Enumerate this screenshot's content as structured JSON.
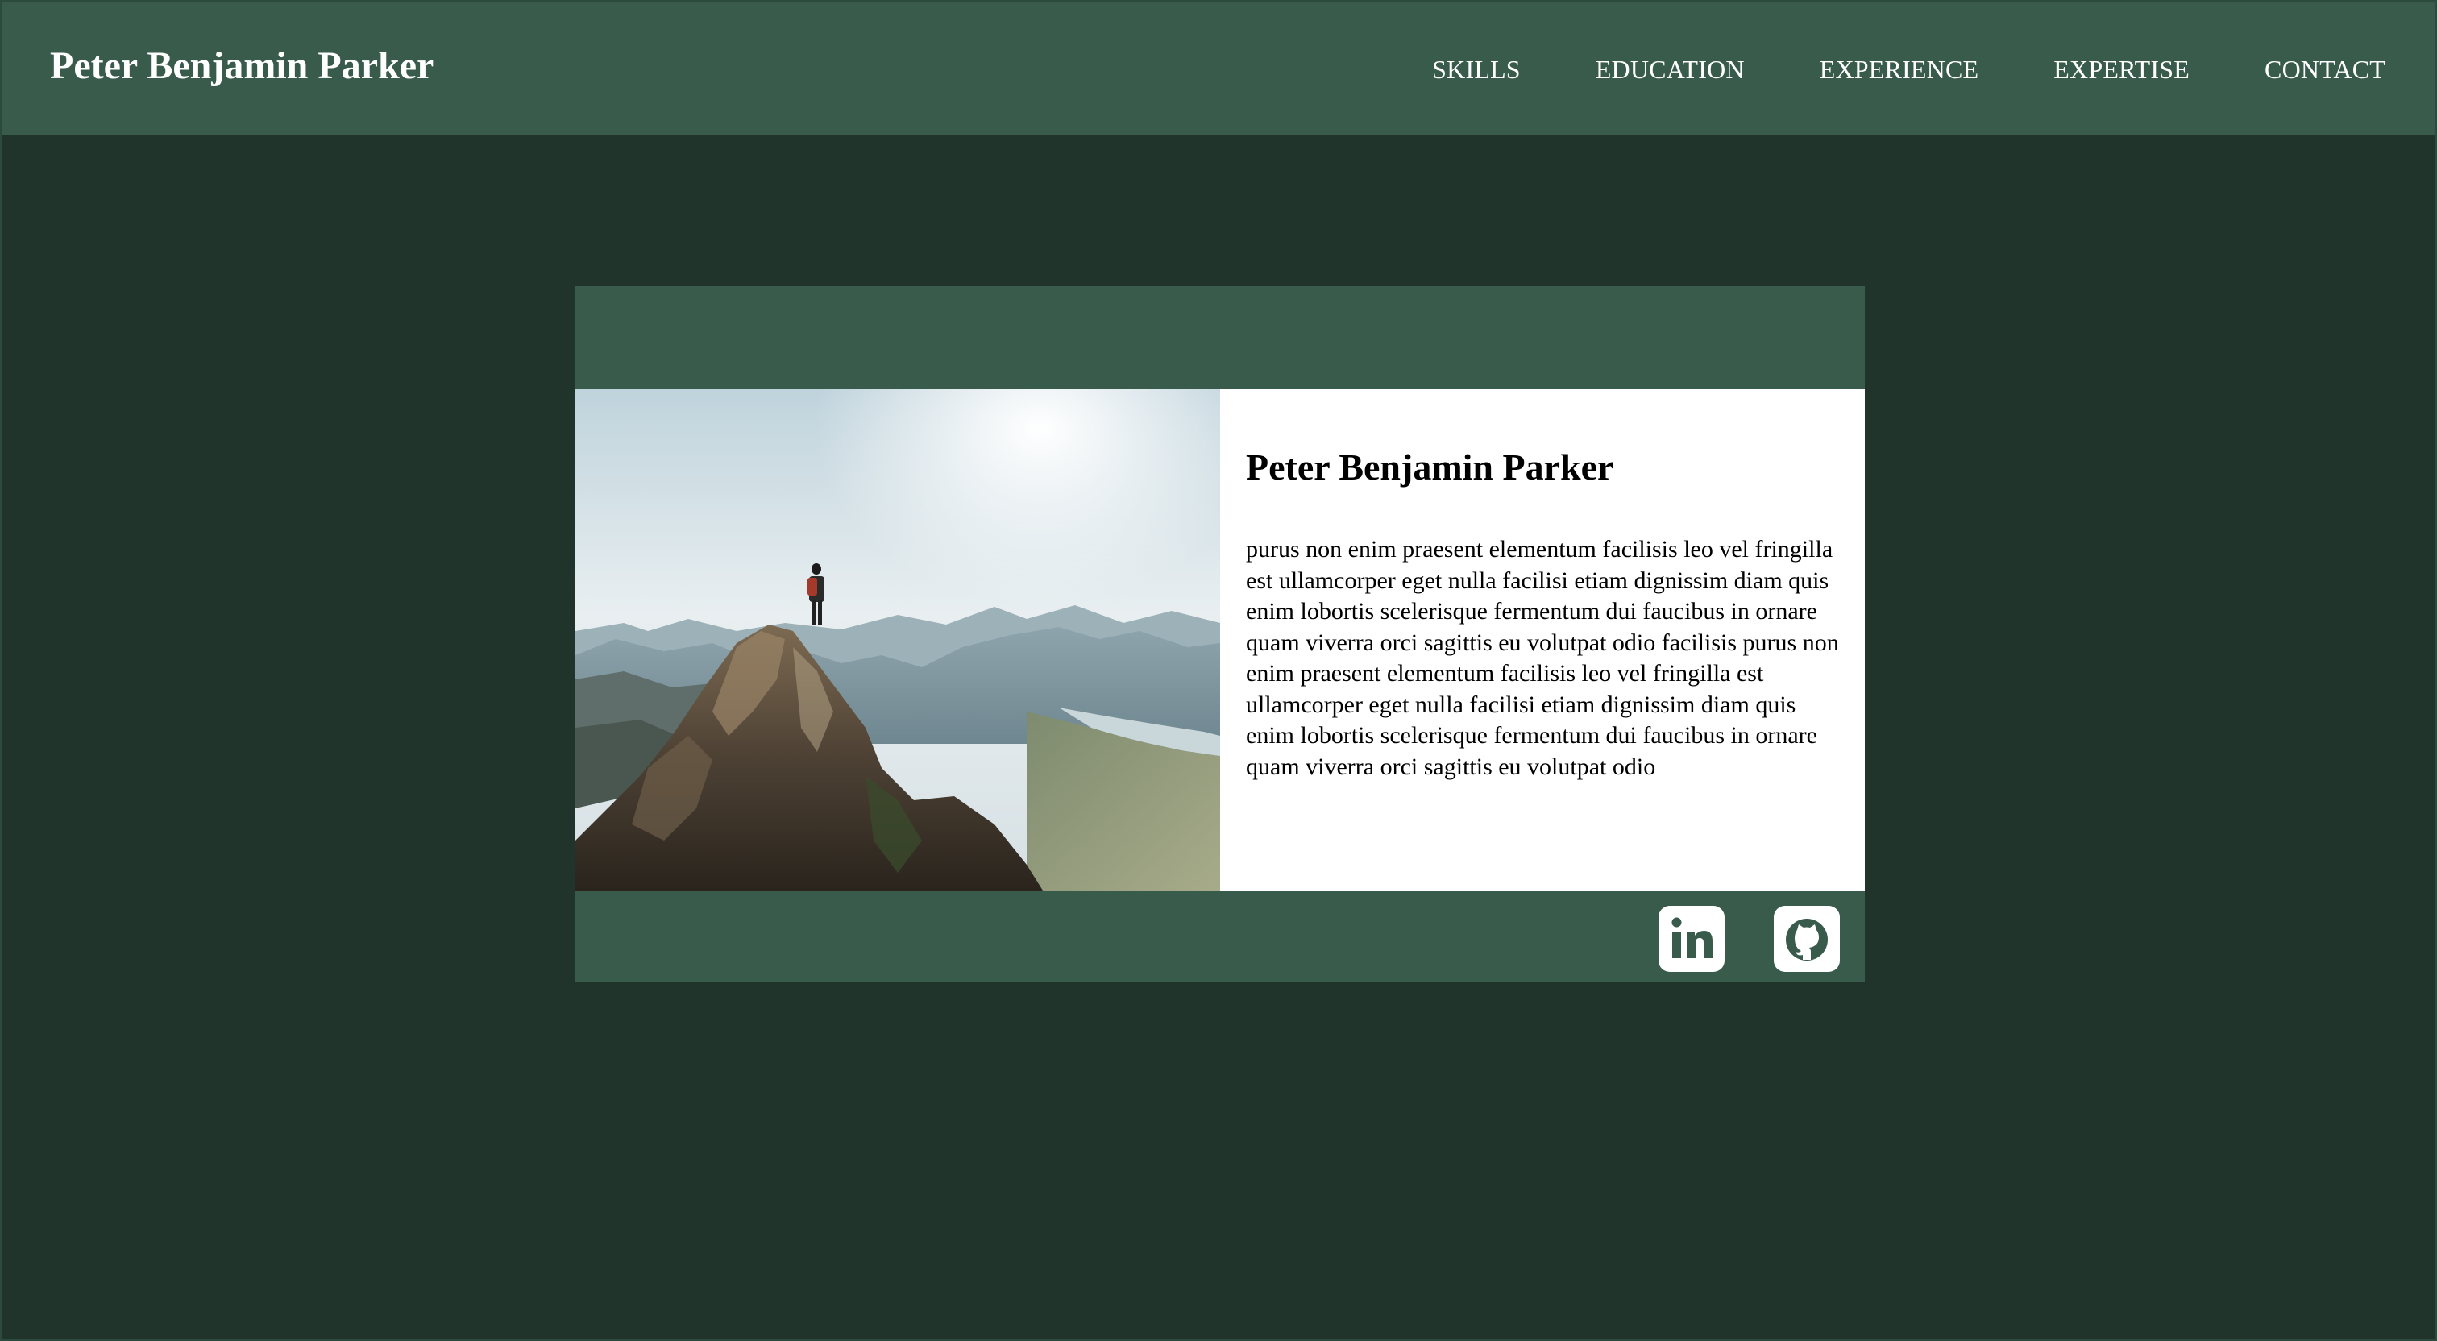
{
  "header": {
    "brand": "Peter Benjamin Parker",
    "nav": [
      {
        "label": "SKILLS"
      },
      {
        "label": "EDUCATION"
      },
      {
        "label": "EXPERIENCE"
      },
      {
        "label": "EXPERTISE"
      },
      {
        "label": "CONTACT"
      }
    ]
  },
  "profile": {
    "name": "Peter Benjamin Parker",
    "bio": "purus non enim praesent elementum facilisis leo vel fringilla est ullamcorper eget nulla facilisi etiam dignissim diam quis enim lobortis scelerisque fermentum dui faucibus in ornare quam viverra orci sagittis eu volutpat odio facilisis purus non enim praesent elementum facilisis leo vel fringilla est ullamcorper eget nulla facilisi etiam dignissim diam quis enim lobortis scelerisque fermentum dui faucibus in ornare quam viverra orci sagittis eu volutpat odio",
    "photo": "hiker-on-mountain-peak"
  },
  "social": [
    {
      "icon": "linkedin-icon"
    },
    {
      "icon": "github-icon"
    }
  ],
  "colors": {
    "page_background": "#20342c",
    "accent": "#385b4b",
    "card_text_background": "#ffffff",
    "text_light": "#ffffff",
    "text_dark": "#000000"
  }
}
